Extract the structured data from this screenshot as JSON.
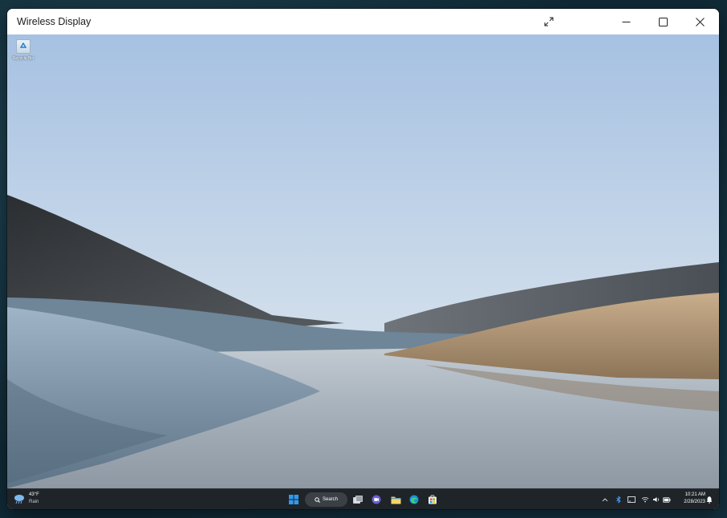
{
  "window": {
    "title": "Wireless Display",
    "controls": [
      "expand-icon",
      "minimize-icon",
      "maximize-icon",
      "close-icon"
    ]
  },
  "desktop": {
    "icons": [
      {
        "label": "Recycle Bin",
        "icon": "recycle-bin-icon"
      }
    ]
  },
  "taskbar": {
    "weather": {
      "temperature": "43°F",
      "condition": "Rain",
      "icon": "rain-cloud-icon"
    },
    "search_label": "Search",
    "pinned_apps": [
      "start-icon",
      "search-icon",
      "task-view-icon",
      "teams-chat-icon",
      "file-explorer-icon",
      "edge-icon",
      "microsoft-store-icon"
    ],
    "tray_icons": [
      "chevron-up-icon",
      "bluetooth-icon",
      "cast-icon",
      "wifi-icon",
      "volume-icon",
      "battery-icon"
    ],
    "time": "10:21 AM",
    "date": "2/28/2023",
    "notification_icon": "notification-icon"
  },
  "colors": {
    "taskbar_bg": "#1f2429",
    "accent": "#0078d4",
    "sky_top": "#a6c1e2",
    "sky_bottom": "#e4ecf1"
  }
}
